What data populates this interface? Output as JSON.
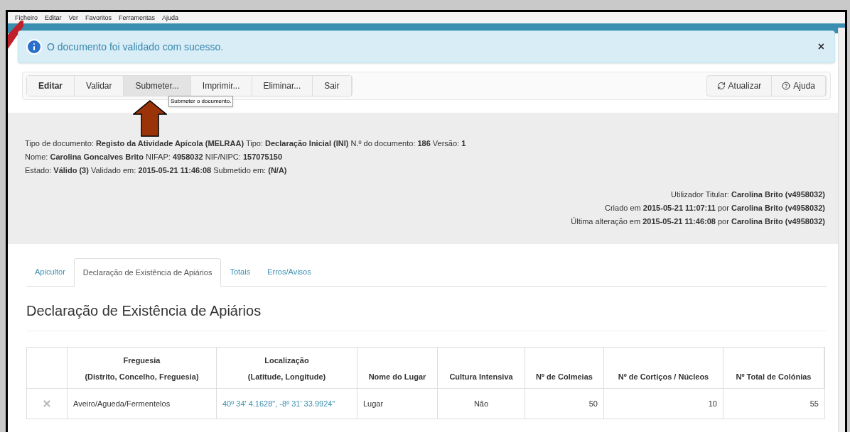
{
  "menu_bar": [
    "Ficheiro",
    "Editar",
    "Ver",
    "Favoritos",
    "Ferramentas",
    "Ajuda"
  ],
  "alert": {
    "message": "O documento foi validado com sucesso.",
    "close": "×"
  },
  "toolbar": {
    "left": [
      {
        "label": "Editar",
        "bold": true,
        "selected": false
      },
      {
        "label": "Validar",
        "bold": false,
        "selected": false
      },
      {
        "label": "Submeter...",
        "bold": false,
        "selected": true
      },
      {
        "label": "Imprimir...",
        "bold": false,
        "selected": false
      },
      {
        "label": "Eliminar...",
        "bold": false,
        "selected": false
      },
      {
        "label": "Sair",
        "bold": false,
        "selected": false
      }
    ],
    "right": [
      {
        "label": "Atualizar",
        "kind": "refresh"
      },
      {
        "label": "Ajuda",
        "kind": "help"
      }
    ],
    "tooltip": "Submeter o documento."
  },
  "header": {
    "left": [
      "Tipo de documento: **Registo da Atividade Apícola (MELRAA)** Tipo: **Declaração Inicial (INI)** N.º do documento: **186** Versão: **1**",
      "Nome: **Carolina Goncalves Brito** NIFAP: **4958032** NIF/NIPC: **157075150**",
      "Estado: **Válido (3)** Validado em: **2015-05-21 11:46:08** Submetido em: **(N/A)**"
    ],
    "right": [
      "Utilizador Titular: **Carolina Brito (v4958032)**",
      "Criado em **2015-05-21 11:07:11** por **Carolina Brito (v4958032)**",
      "Última alteração em **2015-05-21 11:46:08** por **Carolina Brito (v4958032)**"
    ]
  },
  "tabs": [
    {
      "label": "Apicultor",
      "selected": false
    },
    {
      "label": "Declaração de Existência de Apiários",
      "selected": true
    },
    {
      "label": "Totais",
      "selected": false
    },
    {
      "label": "Erros/Avisos",
      "selected": false
    }
  ],
  "heading": "Declaração de Existência de Apiários",
  "table": {
    "columns": [
      {},
      {
        "lines": [
          "Freguesia",
          "(Distrito, Concelho, Freguesia)"
        ]
      },
      {
        "lines": [
          "Localização",
          "(Latitude, Longitude)"
        ]
      },
      {
        "lines": [
          "Nome do Lugar"
        ]
      },
      {
        "lines": [
          "Cultura Intensiva"
        ]
      },
      {
        "lines": [
          "Nº de Colmeias"
        ]
      },
      {
        "lines": [
          "Nº de Cortiços / Núcleos"
        ]
      },
      {
        "lines": [
          "Nº Total de Colónias"
        ]
      }
    ],
    "rows": [
      {
        "freguesia": "Aveiro/Agueda/Fermentelos",
        "localizacao": "40º 34' 4.1628\", -8º 31' 33.9924\"",
        "lugar": "Lugar",
        "cultura": "Não",
        "colmeias": "50",
        "corticos": "10",
        "total": "55"
      }
    ]
  }
}
